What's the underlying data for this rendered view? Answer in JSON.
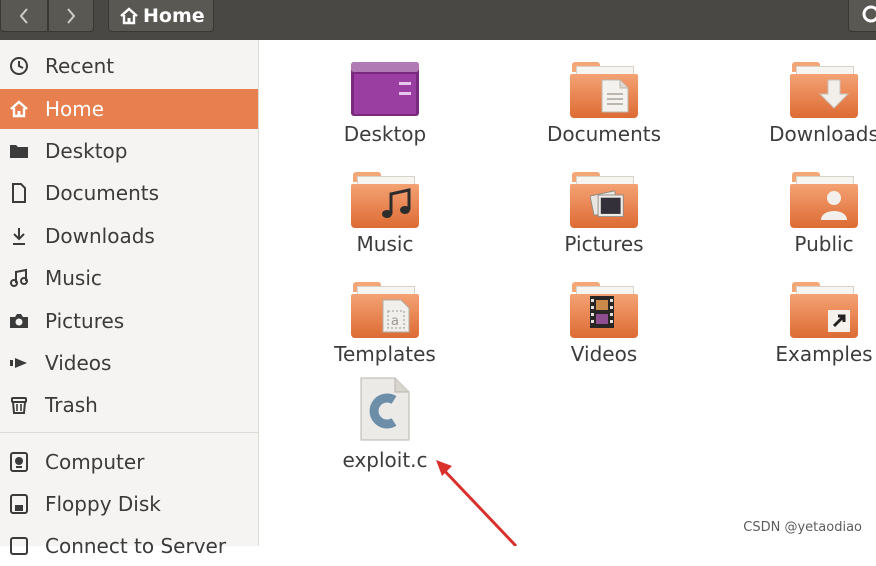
{
  "header": {
    "back_icon": "chevron-left-icon",
    "forward_icon": "chevron-right-icon",
    "path_label": "Home",
    "path_icon": "home-icon",
    "search_icon": "search-icon"
  },
  "sidebar": {
    "items": [
      {
        "label": "Recent",
        "icon": "clock-icon"
      },
      {
        "label": "Home",
        "icon": "home-icon",
        "active": true
      },
      {
        "label": "Desktop",
        "icon": "folder-icon"
      },
      {
        "label": "Documents",
        "icon": "document-icon"
      },
      {
        "label": "Downloads",
        "icon": "download-icon"
      },
      {
        "label": "Music",
        "icon": "music-icon"
      },
      {
        "label": "Pictures",
        "icon": "camera-icon"
      },
      {
        "label": "Videos",
        "icon": "video-icon"
      },
      {
        "label": "Trash",
        "icon": "trash-icon"
      },
      {
        "label": "Computer",
        "icon": "computer-icon"
      },
      {
        "label": "Floppy Disk",
        "icon": "floppy-icon"
      },
      {
        "label": "Connect to Server",
        "icon": "server-icon"
      }
    ],
    "active_color": "#e7804e"
  },
  "files": [
    {
      "label": "Desktop",
      "icon": "desktop-folder-icon"
    },
    {
      "label": "Documents",
      "icon": "documents-folder-icon"
    },
    {
      "label": "Downloads",
      "icon": "downloads-folder-icon"
    },
    {
      "label": "Music",
      "icon": "music-folder-icon"
    },
    {
      "label": "Pictures",
      "icon": "pictures-folder-icon"
    },
    {
      "label": "Public",
      "icon": "public-folder-icon"
    },
    {
      "label": "Templates",
      "icon": "templates-folder-icon"
    },
    {
      "label": "Videos",
      "icon": "videos-folder-icon"
    },
    {
      "label": "Examples",
      "icon": "examples-folder-icon"
    },
    {
      "label": "exploit.c",
      "icon": "c-source-file-icon"
    }
  ],
  "watermark": "CSDN @yetaodiao",
  "annotation": {
    "icon": "red-arrow-icon",
    "color": "#d9302b"
  }
}
